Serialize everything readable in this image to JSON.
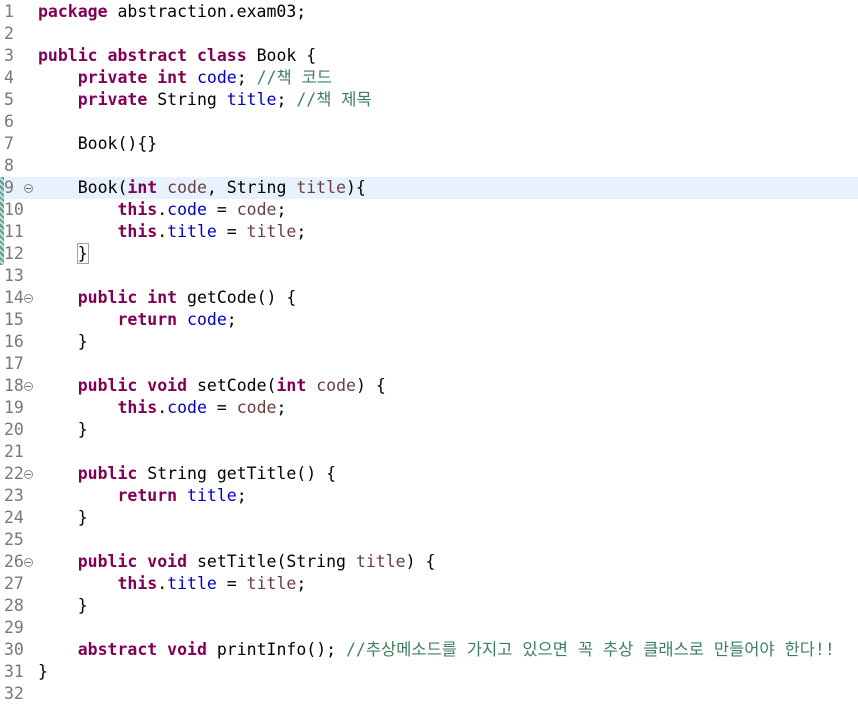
{
  "editor": {
    "current_line": 9,
    "lines": [
      {
        "n": "1",
        "fold": false,
        "changed": false,
        "tokens": [
          [
            "k",
            "package"
          ],
          [
            "t",
            " abstraction.exam03;"
          ]
        ]
      },
      {
        "n": "2",
        "fold": false,
        "changed": false,
        "tokens": []
      },
      {
        "n": "3",
        "fold": false,
        "changed": false,
        "tokens": [
          [
            "k",
            "public"
          ],
          [
            "t",
            " "
          ],
          [
            "k",
            "abstract"
          ],
          [
            "t",
            " "
          ],
          [
            "k",
            "class"
          ],
          [
            "t",
            " Book {"
          ]
        ]
      },
      {
        "n": "4",
        "fold": false,
        "changed": false,
        "tokens": [
          [
            "t",
            "    "
          ],
          [
            "k",
            "private"
          ],
          [
            "t",
            " "
          ],
          [
            "k",
            "int"
          ],
          [
            "t",
            " "
          ],
          [
            "f",
            "code"
          ],
          [
            "t",
            "; "
          ],
          [
            "c",
            "//책 코드"
          ]
        ]
      },
      {
        "n": "5",
        "fold": false,
        "changed": false,
        "tokens": [
          [
            "t",
            "    "
          ],
          [
            "k",
            "private"
          ],
          [
            "t",
            " String "
          ],
          [
            "f",
            "title"
          ],
          [
            "t",
            "; "
          ],
          [
            "c",
            "//책 제목"
          ]
        ]
      },
      {
        "n": "6",
        "fold": false,
        "changed": false,
        "tokens": []
      },
      {
        "n": "7",
        "fold": false,
        "changed": false,
        "tokens": [
          [
            "t",
            "    Book(){}"
          ]
        ]
      },
      {
        "n": "8",
        "fold": false,
        "changed": false,
        "tokens": []
      },
      {
        "n": "9",
        "fold": true,
        "changed": true,
        "tokens": [
          [
            "t",
            "    Book("
          ],
          [
            "k",
            "int"
          ],
          [
            "t",
            " "
          ],
          [
            "p",
            "code"
          ],
          [
            "t",
            ", String "
          ],
          [
            "p",
            "title"
          ],
          [
            "t",
            "){"
          ]
        ]
      },
      {
        "n": "10",
        "fold": false,
        "changed": true,
        "tokens": [
          [
            "t",
            "        "
          ],
          [
            "k",
            "this"
          ],
          [
            "t",
            "."
          ],
          [
            "f",
            "code"
          ],
          [
            "t",
            " = "
          ],
          [
            "p",
            "code"
          ],
          [
            "t",
            ";"
          ]
        ]
      },
      {
        "n": "11",
        "fold": false,
        "changed": true,
        "tokens": [
          [
            "t",
            "        "
          ],
          [
            "k",
            "this"
          ],
          [
            "t",
            "."
          ],
          [
            "f",
            "title"
          ],
          [
            "t",
            " = "
          ],
          [
            "p",
            "title"
          ],
          [
            "t",
            ";"
          ]
        ]
      },
      {
        "n": "12",
        "fold": false,
        "changed": true,
        "tokens": [
          [
            "t",
            "    "
          ],
          [
            "b",
            "}"
          ]
        ]
      },
      {
        "n": "13",
        "fold": false,
        "changed": false,
        "tokens": []
      },
      {
        "n": "14",
        "fold": true,
        "changed": false,
        "tokens": [
          [
            "t",
            "    "
          ],
          [
            "k",
            "public"
          ],
          [
            "t",
            " "
          ],
          [
            "k",
            "int"
          ],
          [
            "t",
            " getCode() {"
          ]
        ]
      },
      {
        "n": "15",
        "fold": false,
        "changed": false,
        "tokens": [
          [
            "t",
            "        "
          ],
          [
            "k",
            "return"
          ],
          [
            "t",
            " "
          ],
          [
            "f",
            "code"
          ],
          [
            "t",
            ";"
          ]
        ]
      },
      {
        "n": "16",
        "fold": false,
        "changed": false,
        "tokens": [
          [
            "t",
            "    }"
          ]
        ]
      },
      {
        "n": "17",
        "fold": false,
        "changed": false,
        "tokens": []
      },
      {
        "n": "18",
        "fold": true,
        "changed": false,
        "tokens": [
          [
            "t",
            "    "
          ],
          [
            "k",
            "public"
          ],
          [
            "t",
            " "
          ],
          [
            "k",
            "void"
          ],
          [
            "t",
            " setCode("
          ],
          [
            "k",
            "int"
          ],
          [
            "t",
            " "
          ],
          [
            "p",
            "code"
          ],
          [
            "t",
            ") {"
          ]
        ]
      },
      {
        "n": "19",
        "fold": false,
        "changed": false,
        "tokens": [
          [
            "t",
            "        "
          ],
          [
            "k",
            "this"
          ],
          [
            "t",
            "."
          ],
          [
            "f",
            "code"
          ],
          [
            "t",
            " = "
          ],
          [
            "p",
            "code"
          ],
          [
            "t",
            ";"
          ]
        ]
      },
      {
        "n": "20",
        "fold": false,
        "changed": false,
        "tokens": [
          [
            "t",
            "    }"
          ]
        ]
      },
      {
        "n": "21",
        "fold": false,
        "changed": false,
        "tokens": []
      },
      {
        "n": "22",
        "fold": true,
        "changed": false,
        "tokens": [
          [
            "t",
            "    "
          ],
          [
            "k",
            "public"
          ],
          [
            "t",
            " String getTitle() {"
          ]
        ]
      },
      {
        "n": "23",
        "fold": false,
        "changed": false,
        "tokens": [
          [
            "t",
            "        "
          ],
          [
            "k",
            "return"
          ],
          [
            "t",
            " "
          ],
          [
            "f",
            "title"
          ],
          [
            "t",
            ";"
          ]
        ]
      },
      {
        "n": "24",
        "fold": false,
        "changed": false,
        "tokens": [
          [
            "t",
            "    }"
          ]
        ]
      },
      {
        "n": "25",
        "fold": false,
        "changed": false,
        "tokens": []
      },
      {
        "n": "26",
        "fold": true,
        "changed": false,
        "tokens": [
          [
            "t",
            "    "
          ],
          [
            "k",
            "public"
          ],
          [
            "t",
            " "
          ],
          [
            "k",
            "void"
          ],
          [
            "t",
            " setTitle(String "
          ],
          [
            "p",
            "title"
          ],
          [
            "t",
            ") {"
          ]
        ]
      },
      {
        "n": "27",
        "fold": false,
        "changed": false,
        "tokens": [
          [
            "t",
            "        "
          ],
          [
            "k",
            "this"
          ],
          [
            "t",
            "."
          ],
          [
            "f",
            "title"
          ],
          [
            "t",
            " = "
          ],
          [
            "p",
            "title"
          ],
          [
            "t",
            ";"
          ]
        ]
      },
      {
        "n": "28",
        "fold": false,
        "changed": false,
        "tokens": [
          [
            "t",
            "    }"
          ]
        ]
      },
      {
        "n": "29",
        "fold": false,
        "changed": false,
        "tokens": []
      },
      {
        "n": "30",
        "fold": false,
        "changed": false,
        "tokens": [
          [
            "t",
            "    "
          ],
          [
            "k",
            "abstract"
          ],
          [
            "t",
            " "
          ],
          [
            "k",
            "void"
          ],
          [
            "t",
            " printInfo(); "
          ],
          [
            "c",
            "//추상메소드를 가지고 있으면 꼭 추상 클래스로 만들어야 한다!!"
          ]
        ]
      },
      {
        "n": "31",
        "fold": false,
        "changed": false,
        "tokens": [
          [
            "t",
            "}"
          ]
        ]
      },
      {
        "n": "32",
        "fold": false,
        "changed": false,
        "tokens": []
      }
    ]
  },
  "colors": {
    "keyword": "#7f0055",
    "field": "#0000c0",
    "parameter": "#6a3e3e",
    "comment": "#3f7f5f",
    "current_line_bg": "#e8f2fe"
  },
  "icons": {
    "fold": "fold-toggle-icon",
    "change": "change-marker-icon"
  }
}
